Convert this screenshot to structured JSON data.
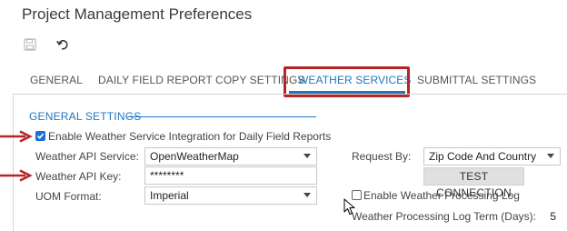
{
  "window": {
    "title": "Project Management Preferences"
  },
  "toolbar": {
    "save_icon": "save-icon",
    "undo_icon": "undo-icon"
  },
  "tabs": [
    {
      "label": "GENERAL",
      "active": false
    },
    {
      "label": "DAILY FIELD REPORT COPY SETTINGS",
      "active": false
    },
    {
      "label": "WEATHER SERVICES",
      "active": true
    },
    {
      "label": "SUBMITTAL SETTINGS",
      "active": false
    }
  ],
  "section": {
    "title": "GENERAL SETTINGS"
  },
  "form": {
    "enable_integration": {
      "label": "Enable Weather Service Integration for Daily Field Reports",
      "checked": true
    },
    "weather_api_service": {
      "label": "Weather API Service:",
      "value": "OpenWeatherMap"
    },
    "weather_api_key": {
      "label": "Weather API Key:",
      "value": "********"
    },
    "uom_format": {
      "label": "UOM Format:",
      "value": "Imperial"
    },
    "request_by": {
      "label": "Request By:",
      "value": "Zip Code And Country"
    },
    "test_connection": {
      "label": "TEST CONNECTION"
    },
    "enable_log": {
      "label": "Enable Weather Processing Log",
      "checked": false
    },
    "log_term": {
      "label": "Weather Processing Log Term (Days):",
      "value": "5"
    }
  },
  "colors": {
    "accent": "#1f77c0",
    "annotation": "#b52528"
  }
}
